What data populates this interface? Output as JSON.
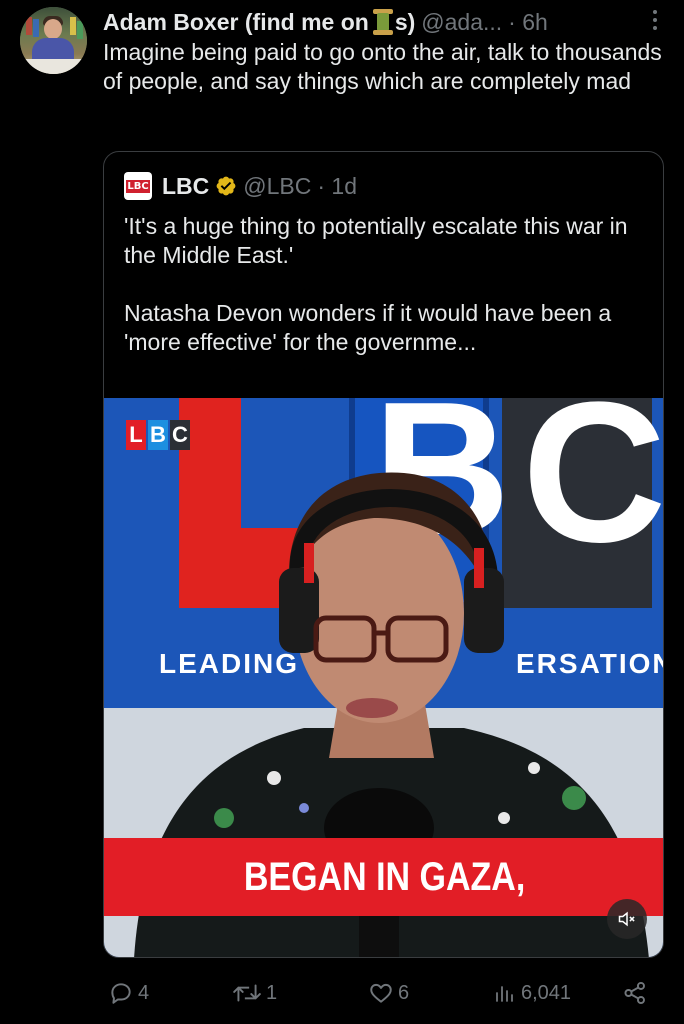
{
  "tweet": {
    "author_name": "Adam Boxer (find me on",
    "author_name_suffix": "s)",
    "handle": "@ada...",
    "time": "· 6h",
    "text": "Imagine being paid to go onto the air, talk to thousands of people, and say things which are completely mad"
  },
  "quoted": {
    "logo_text": "LBC",
    "name": "LBC",
    "handle": "@LBC",
    "time": "· 1d",
    "paragraph1": "'It's a huge thing to potentially escalate this war in the Middle East.'",
    "paragraph2": "Natasha Devon wonders if it would have been a 'more effective' for the governme...",
    "video": {
      "bg_letter_L": "L",
      "bg_letter_B": "B",
      "bg_letter_C": "C",
      "leading_text": "LEADING B",
      "ersation_text": "ERSATION",
      "small_logo": [
        "L",
        "B",
        "C"
      ],
      "caption": "BEGAN IN GAZA,"
    }
  },
  "actions": {
    "replies": "4",
    "reposts": "1",
    "likes": "6",
    "views": "6,041"
  },
  "colors": {
    "background": "#000000",
    "text": "#e7e9ea",
    "muted": "#71767b",
    "lbc_red": "#e21e26",
    "lbc_blue": "#1c56b8",
    "verified_gold": "#e2b719"
  }
}
